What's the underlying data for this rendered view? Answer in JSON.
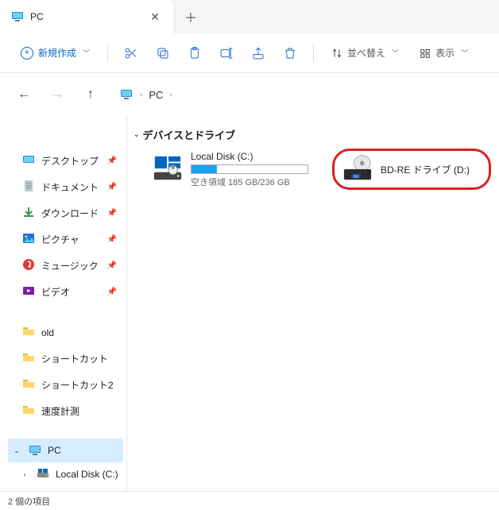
{
  "tab": {
    "title": "PC"
  },
  "toolbar": {
    "new_label": "新規作成",
    "sort_label": "並べ替え",
    "view_label": "表示"
  },
  "breadcrumb": {
    "root": "PC"
  },
  "sidebar": {
    "items": [
      {
        "label": "デスクトップ",
        "type": "desktop",
        "pinned": true
      },
      {
        "label": "ドキュメント",
        "type": "document",
        "pinned": true
      },
      {
        "label": "ダウンロード",
        "type": "download",
        "pinned": true
      },
      {
        "label": "ピクチャ",
        "type": "picture",
        "pinned": true
      },
      {
        "label": "ミュージック",
        "type": "music",
        "pinned": true
      },
      {
        "label": "ビデオ",
        "type": "video",
        "pinned": true
      },
      {
        "label": "old",
        "type": "folder",
        "pinned": false
      },
      {
        "label": "ショートカット",
        "type": "folder",
        "pinned": false
      },
      {
        "label": "ショートカット2",
        "type": "folder",
        "pinned": false
      },
      {
        "label": "速度計測",
        "type": "folder",
        "pinned": false
      }
    ],
    "pc_label": "PC",
    "local_disk_label": "Local Disk (C:)"
  },
  "content": {
    "group_header": "デバイスとドライブ",
    "drives": [
      {
        "name": "Local Disk (C:)",
        "capacity_text": "空き領域 185 GB/236 GB",
        "used_fraction": 0.22
      },
      {
        "name": "BD-RE ドライブ (D:)",
        "highlighted": true
      }
    ]
  },
  "status": {
    "text": "2 個の項目"
  }
}
